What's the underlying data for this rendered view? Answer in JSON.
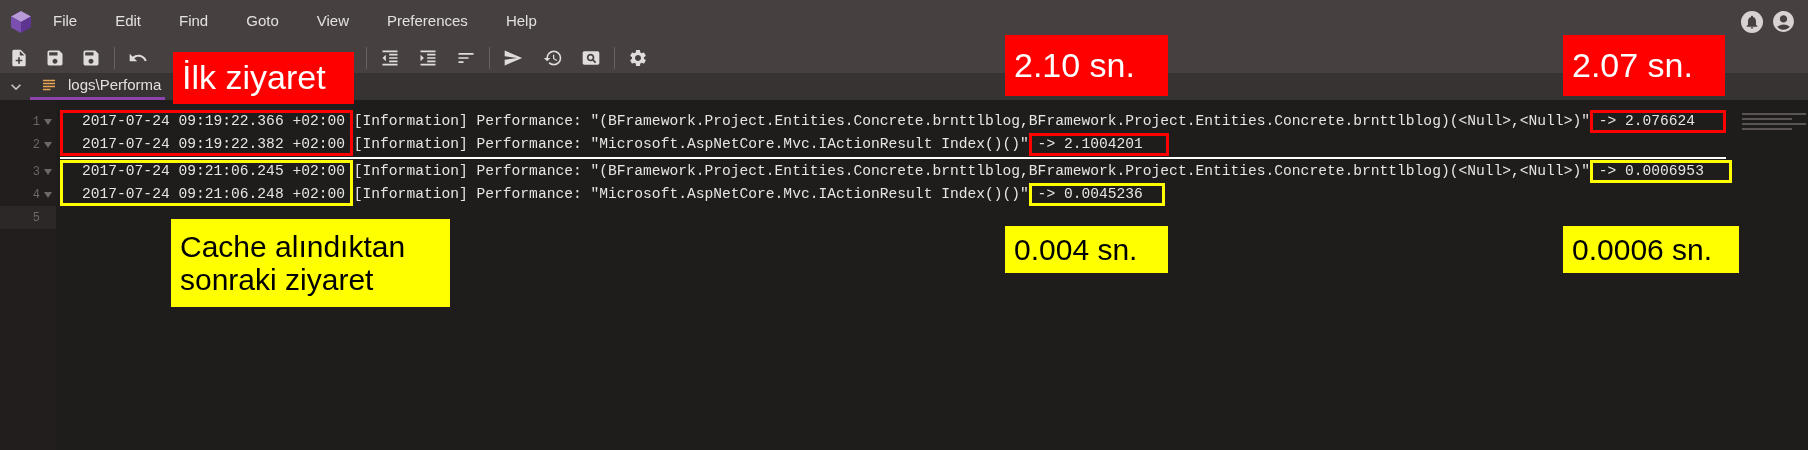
{
  "menu": [
    "File",
    "Edit",
    "Find",
    "Goto",
    "View",
    "Preferences",
    "Help"
  ],
  "tab": {
    "label": "logs\\Performa",
    "selected": true
  },
  "editor": {
    "lines": [
      {
        "number": "1",
        "folded": false,
        "text": "2017-07-24 09:19:22.366 +02:00 [Information] Performance: \"(BFramework.Project.Entities.Concrete.brnttlblog,BFramework.Project.Entities.Concrete.brnttlblog)(<Null>,<Null>)\" -> 2.076624"
      },
      {
        "number": "2",
        "folded": false,
        "text": "2017-07-24 09:19:22.382 +02:00 [Information] Performance: \"Microsoft.AspNetCore.Mvc.IActionResult Index()()\" -> 2.1004201"
      },
      {
        "number": "3",
        "folded": false,
        "text": "2017-07-24 09:21:06.245 +02:00 [Information] Performance: \"(BFramework.Project.Entities.Concrete.brnttlblog,BFramework.Project.Entities.Concrete.brnttlblog)(<Null>,<Null>)\" -> 0.0006953"
      },
      {
        "number": "4",
        "folded": false,
        "text": "2017-07-24 09:21:06.248 +02:00 [Information] Performance: \"Microsoft.AspNetCore.Mvc.IActionResult Index()()\" -> 0.0045236"
      },
      {
        "number": "5"
      }
    ]
  },
  "annotations": {
    "labels": [
      {
        "text": "İlk ziyaret",
        "color": "#ff0000"
      },
      {
        "text": "2.10 sn.",
        "color": "#ff0000"
      },
      {
        "text": "2.07 sn.",
        "color": "#ff0000"
      },
      {
        "text": "Cache alındıktan sonraki ziyaret",
        "color": "#ffff00"
      },
      {
        "text": "0.004 sn.",
        "color": "#ffff00"
      },
      {
        "text": "0.0006 sn.",
        "color": "#ffff00"
      }
    ],
    "boxes": [
      {
        "color": "#ff0000"
      },
      {
        "color": "#ff0000"
      },
      {
        "color": "#ff0000"
      },
      {
        "color": "#ffff00"
      },
      {
        "color": "#ffff00"
      },
      {
        "color": "#ffff00"
      }
    ]
  }
}
